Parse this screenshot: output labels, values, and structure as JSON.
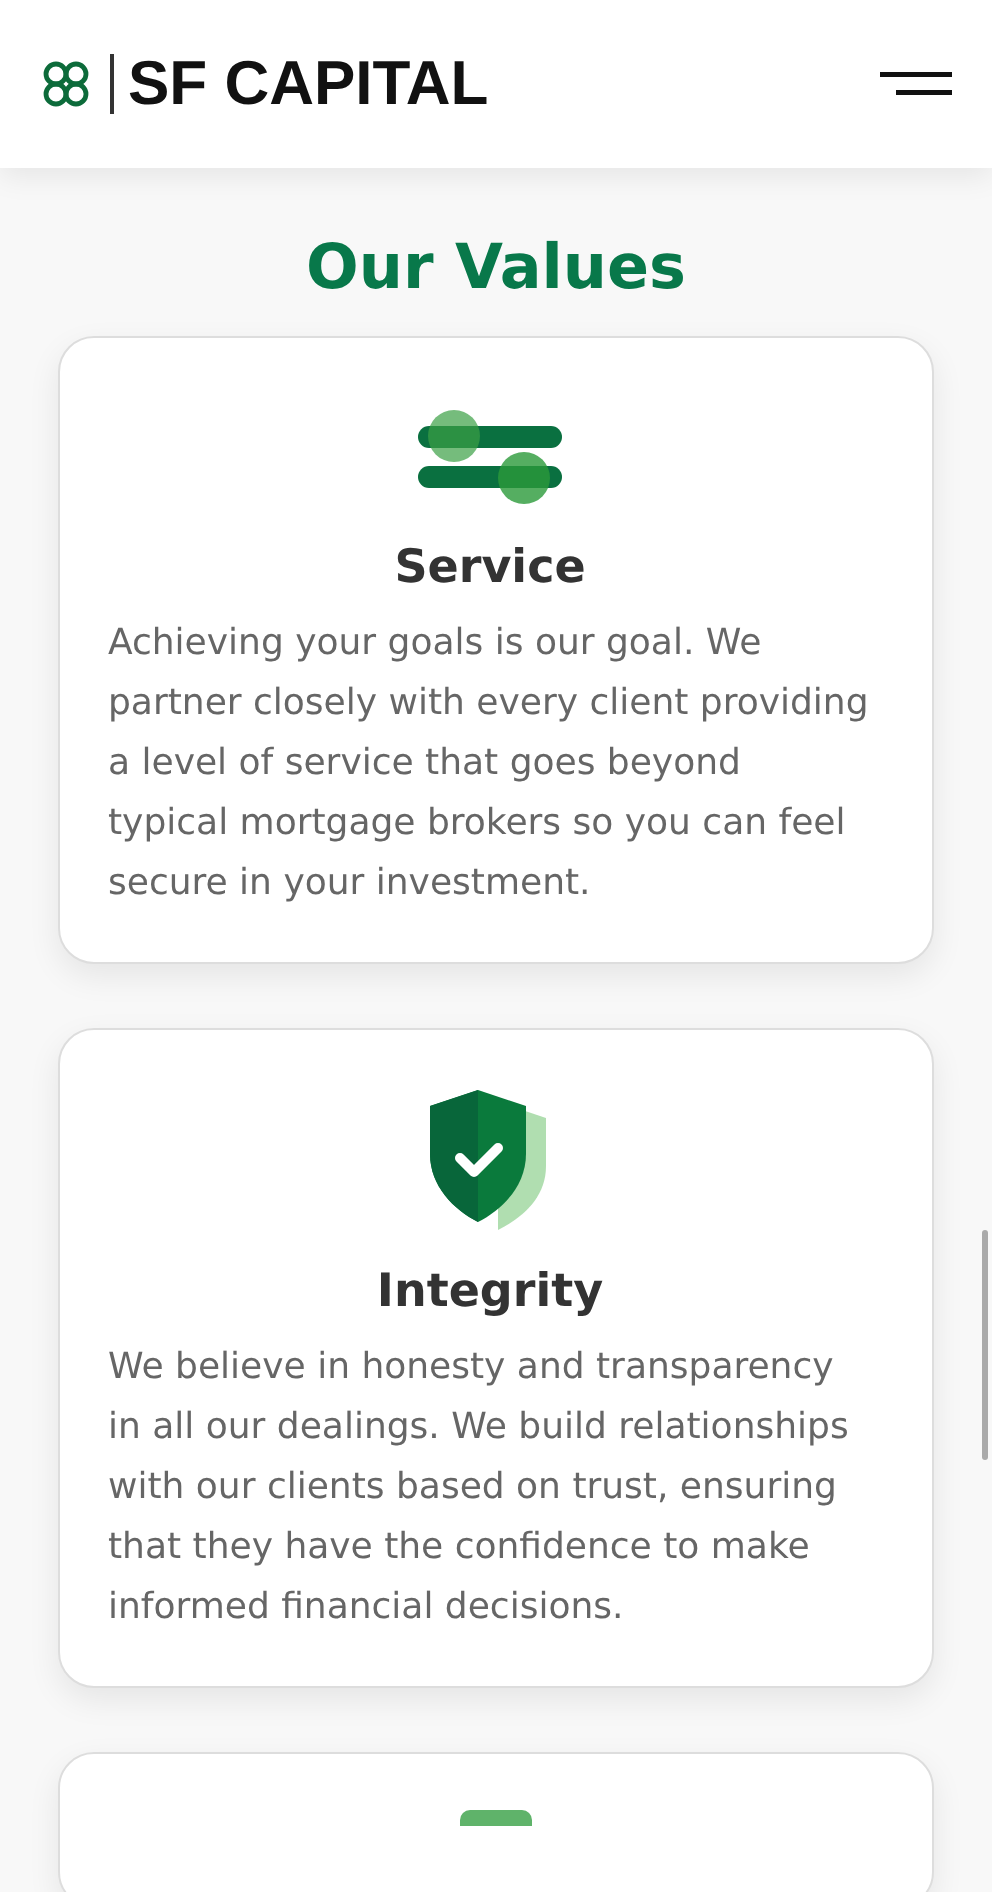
{
  "header": {
    "brand": "SF CAPITAL"
  },
  "section": {
    "title": "Our Values"
  },
  "cards": [
    {
      "kind": "sliders",
      "title": "Service",
      "text": "Achieving your goals is our goal. We partner closely with every client providing a level of service that goes beyond typical mortgage brokers so you can feel secure in your investment."
    },
    {
      "kind": "shield",
      "title": "Integrity",
      "text": "We believe in honesty and transparency in all our dealings. We build relationships with our clients based on trust, ensuring that they have the confidence to make informed financial decisions."
    },
    {
      "kind": "partial"
    }
  ]
}
